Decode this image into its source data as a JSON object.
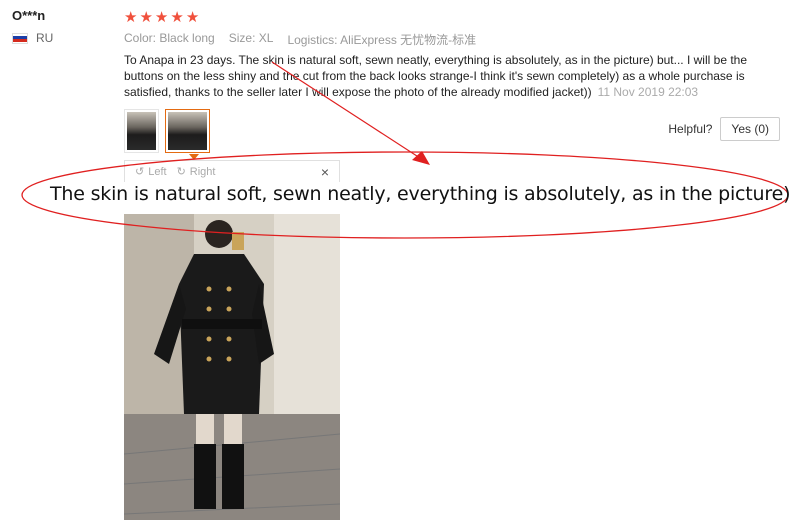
{
  "reviewer": {
    "name": "O***n",
    "country": "RU"
  },
  "rating": {
    "stars": 5,
    "max": 5
  },
  "attributes": [
    {
      "key": "Color:",
      "value": "Black long"
    },
    {
      "key": "Size:",
      "value": "XL"
    },
    {
      "key": "Logistics:",
      "value": "AliExpress 无忧物流-标准"
    }
  ],
  "review": {
    "text": "To Anapa in 23 days. The skin is natural soft, sewn neatly, everything is absolutely, as in the picture) but... I will be the buttons on the less shiny and the cut from the back looks strange-I think it's sewn completely) as a whole purchase is satisfied, thanks to the seller later I will expose the photo of the already modified jacket))",
    "date": "11 Nov 2019 22:03"
  },
  "helpful": {
    "label": "Helpful?",
    "yes_label": "Yes (0)"
  },
  "viewer": {
    "rotate_left": "Left",
    "rotate_right": "Right",
    "close": "×"
  },
  "annotation": {
    "zoomed_text": "The skin is natural soft, sewn neatly, everything is absolutely, as in the picture)",
    "color": "#e02020"
  },
  "colors": {
    "star": "#f0503c",
    "accent": "#e46b12"
  }
}
